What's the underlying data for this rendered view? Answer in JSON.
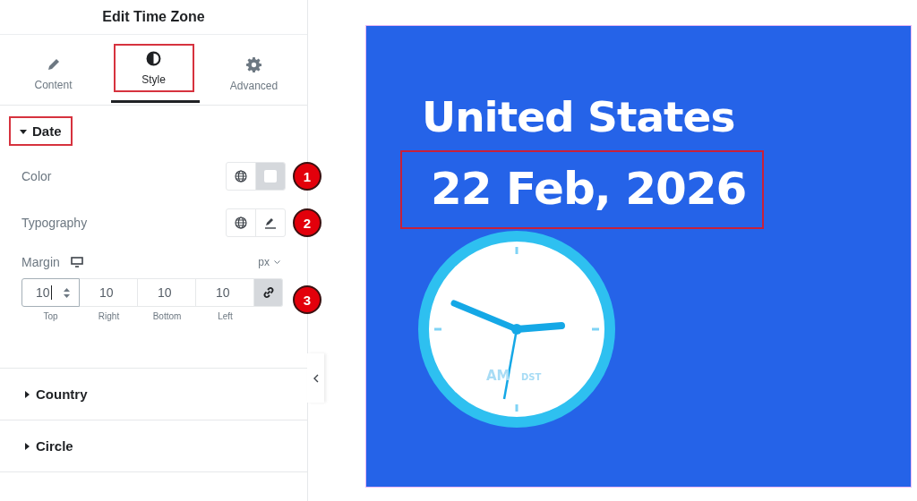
{
  "panel": {
    "title": "Edit Time Zone",
    "tabs": [
      {
        "label": "Content",
        "selected": false,
        "highlighted": false
      },
      {
        "label": "Style",
        "selected": true,
        "highlighted": true
      },
      {
        "label": "Advanced",
        "selected": false,
        "highlighted": false
      }
    ],
    "sections": [
      {
        "title": "Date",
        "expanded": true,
        "highlighted": true,
        "controls": [
          {
            "kind": "color",
            "label": "Color",
            "badge": "1"
          },
          {
            "kind": "typography",
            "label": "Typography",
            "badge": "2"
          },
          {
            "kind": "dimensions",
            "label": "Margin",
            "unit": "px",
            "badge": "3",
            "linked": true,
            "fields": [
              {
                "value": "10",
                "label": "Top",
                "focused": true
              },
              {
                "value": "10",
                "label": "Right",
                "focused": false
              },
              {
                "value": "10",
                "label": "Bottom",
                "focused": false
              },
              {
                "value": "10",
                "label": "Left",
                "focused": false
              }
            ]
          }
        ]
      },
      {
        "title": "Country",
        "expanded": false,
        "highlighted": false
      },
      {
        "title": "Circle",
        "expanded": false,
        "highlighted": false
      }
    ]
  },
  "preview": {
    "country": "United States",
    "date": "22 Feb, 2026",
    "date_highlighted": true,
    "clock": {
      "period": "AM",
      "dst": "DST"
    }
  }
}
